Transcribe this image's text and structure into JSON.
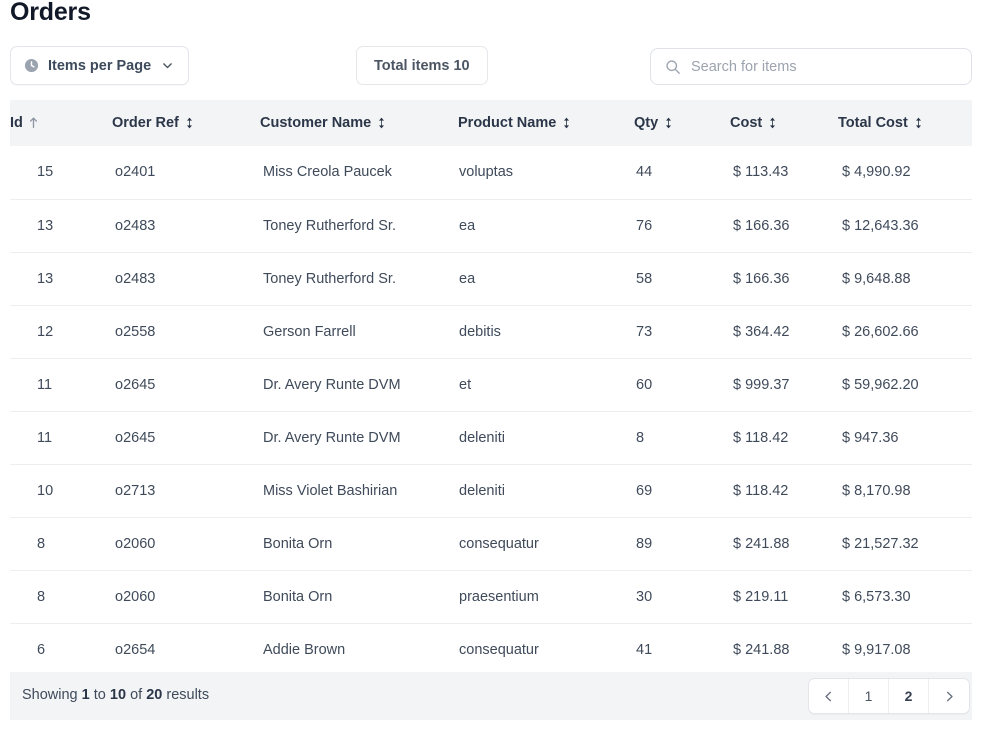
{
  "header": {
    "title": "Orders"
  },
  "toolbar": {
    "items_per_page": {
      "label": "Items per Page",
      "icon": "clock-icon",
      "caret": "chevron-down-icon"
    },
    "total_items_badge": "Total items 10",
    "search": {
      "placeholder": "Search for items",
      "value": "",
      "icon": "search-icon"
    }
  },
  "table": {
    "columns": [
      {
        "key": "id",
        "label": "Id",
        "sort": "asc",
        "sort_icon": "arrow-up-icon"
      },
      {
        "key": "ref",
        "label": "Order Ref",
        "sort": "none",
        "sort_icon": "sort-updown-icon"
      },
      {
        "key": "cust",
        "label": "Customer Name",
        "sort": "none",
        "sort_icon": "sort-updown-icon"
      },
      {
        "key": "prod",
        "label": "Product Name",
        "sort": "none",
        "sort_icon": "sort-updown-icon"
      },
      {
        "key": "qty",
        "label": "Qty",
        "sort": "none",
        "sort_icon": "sort-updown-icon"
      },
      {
        "key": "cost",
        "label": "Cost",
        "sort": "none",
        "sort_icon": "sort-updown-icon"
      },
      {
        "key": "tot",
        "label": "Total Cost",
        "sort": "none",
        "sort_icon": "sort-updown-icon"
      }
    ],
    "rows": [
      {
        "id": "15",
        "ref": "o2401",
        "cust": "Miss Creola Paucek",
        "prod": "voluptas",
        "qty": "44",
        "cost": "$ 113.43",
        "tot": "$ 4,990.92"
      },
      {
        "id": "13",
        "ref": "o2483",
        "cust": "Toney Rutherford Sr.",
        "prod": "ea",
        "qty": "76",
        "cost": "$ 166.36",
        "tot": "$ 12,643.36"
      },
      {
        "id": "13",
        "ref": "o2483",
        "cust": "Toney Rutherford Sr.",
        "prod": "ea",
        "qty": "58",
        "cost": "$ 166.36",
        "tot": "$ 9,648.88"
      },
      {
        "id": "12",
        "ref": "o2558",
        "cust": "Gerson Farrell",
        "prod": "debitis",
        "qty": "73",
        "cost": "$ 364.42",
        "tot": "$ 26,602.66"
      },
      {
        "id": "11",
        "ref": "o2645",
        "cust": "Dr. Avery Runte DVM",
        "prod": "et",
        "qty": "60",
        "cost": "$ 999.37",
        "tot": "$ 59,962.20"
      },
      {
        "id": "11",
        "ref": "o2645",
        "cust": "Dr. Avery Runte DVM",
        "prod": "deleniti",
        "qty": "8",
        "cost": "$ 118.42",
        "tot": "$ 947.36"
      },
      {
        "id": "10",
        "ref": "o2713",
        "cust": "Miss Violet Bashirian",
        "prod": "deleniti",
        "qty": "69",
        "cost": "$ 118.42",
        "tot": "$ 8,170.98"
      },
      {
        "id": "8",
        "ref": "o2060",
        "cust": "Bonita Orn",
        "prod": "consequatur",
        "qty": "89",
        "cost": "$ 241.88",
        "tot": "$ 21,527.32"
      },
      {
        "id": "8",
        "ref": "o2060",
        "cust": "Bonita Orn",
        "prod": "praesentium",
        "qty": "30",
        "cost": "$ 219.11",
        "tot": "$ 6,573.30"
      },
      {
        "id": "6",
        "ref": "o2654",
        "cust": "Addie Brown",
        "prod": "consequatur",
        "qty": "41",
        "cost": "$ 241.88",
        "tot": "$ 9,917.08"
      }
    ]
  },
  "footer": {
    "showing_prefix": "Showing",
    "from": "1",
    "mid": "to",
    "to": "10",
    "of": "of",
    "total": "20",
    "suffix": "results",
    "pagination": {
      "prev_icon": "chevron-left-icon",
      "next_icon": "chevron-right-icon",
      "pages": [
        "1",
        "2"
      ],
      "current": "2"
    }
  },
  "colors": {
    "header_bg": "#f3f4f6",
    "text": "#3f4a5a",
    "heading": "#2b3648",
    "border": "#e5e7eb",
    "placeholder": "#9ca3af"
  }
}
